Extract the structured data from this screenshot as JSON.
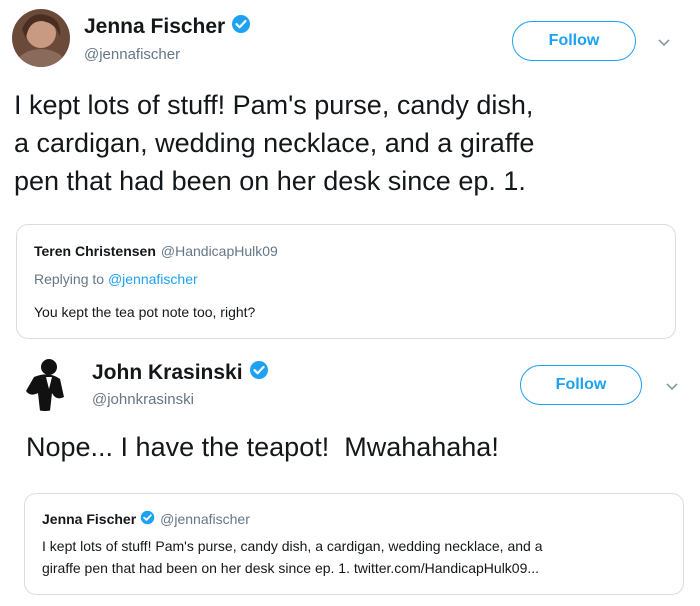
{
  "tweet1": {
    "author_name": "Jenna Fischer",
    "author_handle": "@jennafischer",
    "verified": true,
    "follow_label": "Follow",
    "text_lines": [
      "I kept lots of stuff! Pam's purse, candy dish,",
      "a cardigan, wedding necklace, and a giraffe",
      "pen that had been on her desk since ep. 1."
    ],
    "quoted": {
      "author_name": "Teren Christensen",
      "author_handle": "@HandicapHulk09",
      "replying_prefix": "Replying to ",
      "replying_to": "@jennafischer",
      "text": "You kept the tea pot note too, right?"
    }
  },
  "tweet2": {
    "author_name": "John Krasinski",
    "author_handle": "@johnkrasinski",
    "verified": true,
    "follow_label": "Follow",
    "text": "Nope... I have the teapot!  Mwahahaha!",
    "quoted": {
      "author_name": "Jenna Fischer",
      "author_handle": "@jennafischer",
      "verified": true,
      "text_lines": [
        "I kept lots of stuff! Pam's purse, candy dish, a cardigan, wedding necklace, and a",
        "giraffe pen that had been on her desk since ep. 1. twitter.com/HandicapHulk09..."
      ]
    }
  },
  "colors": {
    "accent": "#1da1f2",
    "text": "#14171a",
    "secondary_text": "#657786",
    "border": "#d9dde1"
  },
  "icons": [
    "verified-badge-icon",
    "chevron-down-icon"
  ]
}
